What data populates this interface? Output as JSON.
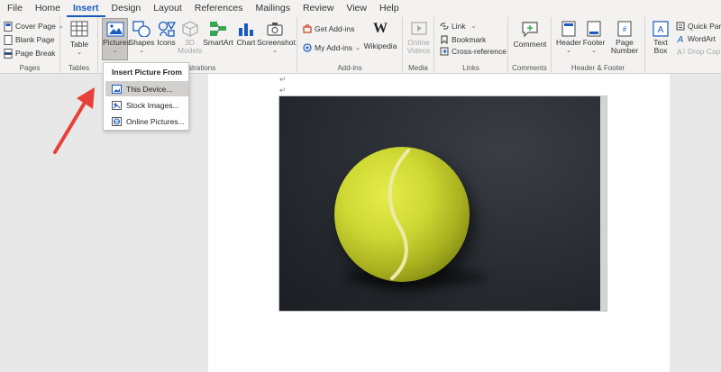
{
  "menu": {
    "tabs": [
      "File",
      "Home",
      "Insert",
      "Design",
      "Layout",
      "References",
      "Mailings",
      "Review",
      "View",
      "Help"
    ],
    "active": "Insert"
  },
  "ribbon": {
    "pages": {
      "cover_page": "Cover Page",
      "blank_page": "Blank Page",
      "page_break": "Page Break",
      "label": "Pages"
    },
    "tables": {
      "table": "Table",
      "label": "Tables"
    },
    "illustrations": {
      "pictures": "Pictures",
      "shapes": "Shapes",
      "icons": "Icons",
      "models_3d_line1": "3D",
      "models_3d_line2": "Models",
      "smartart": "SmartArt",
      "chart": "Chart",
      "screenshot": "Screenshot",
      "label": "Illustrations",
      "label_visible": "strations"
    },
    "addins": {
      "get_addins": "Get Add-ins",
      "my_addins": "My Add-ins",
      "wikipedia": "Wikipedia",
      "wiki_logo": "W",
      "label": "Add-ins"
    },
    "media": {
      "online_videos_line1": "Online",
      "online_videos_line2": "Videos",
      "label": "Media"
    },
    "links": {
      "link": "Link",
      "bookmark": "Bookmark",
      "cross_reference": "Cross-reference",
      "label": "Links"
    },
    "comments": {
      "comment": "Comment",
      "label": "Comments"
    },
    "header_footer": {
      "header": "Header",
      "footer": "Footer",
      "page_number_line1": "Page",
      "page_number_line2": "Number",
      "label": "Header & Footer"
    },
    "text": {
      "text_box_line1": "Text",
      "text_box_line2": "Box",
      "quick_parts": "Quick Parts",
      "wordart": "WordArt",
      "drop_cap": "Drop Cap"
    }
  },
  "dropdown": {
    "title": "Insert Picture From",
    "items": [
      "This Device...",
      "Stock Images...",
      "Online Pictures..."
    ],
    "hovered_index": 0
  },
  "document": {
    "paragraph_mark": "↵"
  },
  "colors": {
    "accent": "#185abd",
    "annotation_arrow": "#e8403a",
    "ribbon_bg": "#f3f2f1"
  }
}
